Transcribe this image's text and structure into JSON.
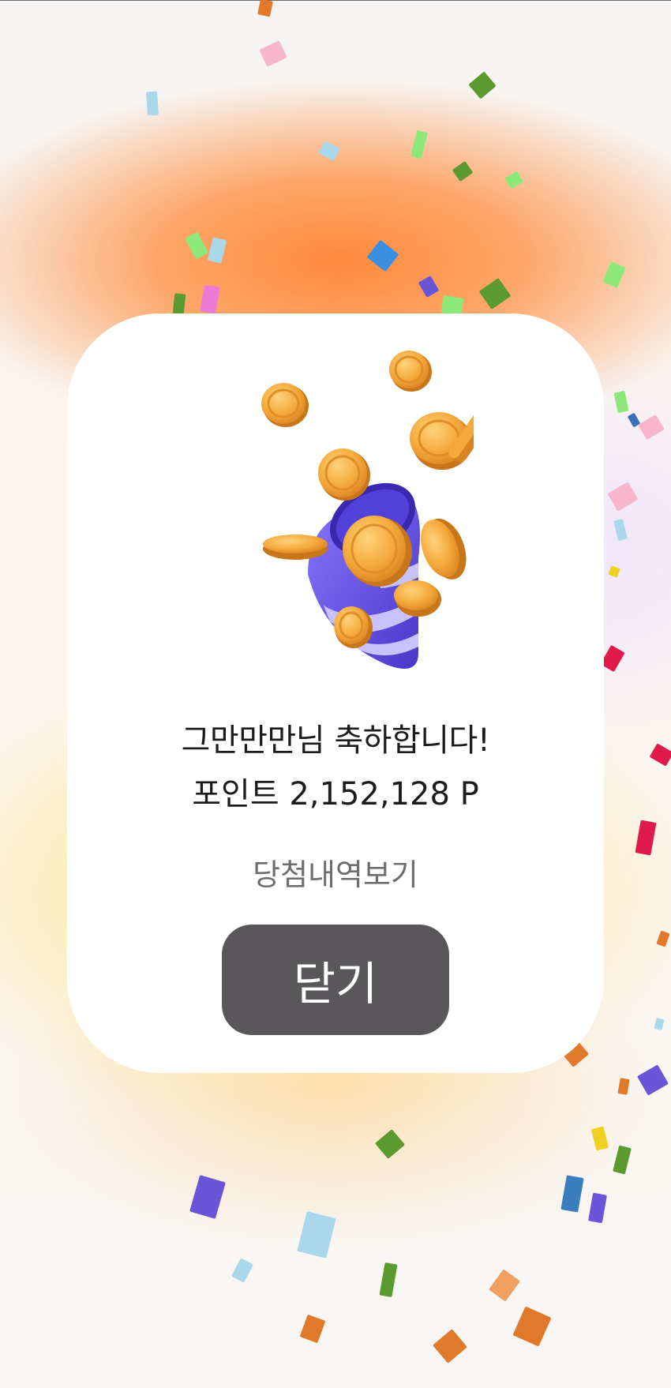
{
  "popup": {
    "title": "그만만만님 축하합니다!",
    "points_text": "포인트 2,152,128 P",
    "history_link_label": "당첨내역보기",
    "close_button_label": "닫기"
  },
  "colors": {
    "card_background": "#ffffff",
    "close_button_background": "#59575a",
    "link_text": "#6e6e6e",
    "coin_gold": "#f4a93b",
    "popper_purple": "#6a55e0"
  },
  "icons": {
    "illustration": "party-popper-with-coins"
  }
}
